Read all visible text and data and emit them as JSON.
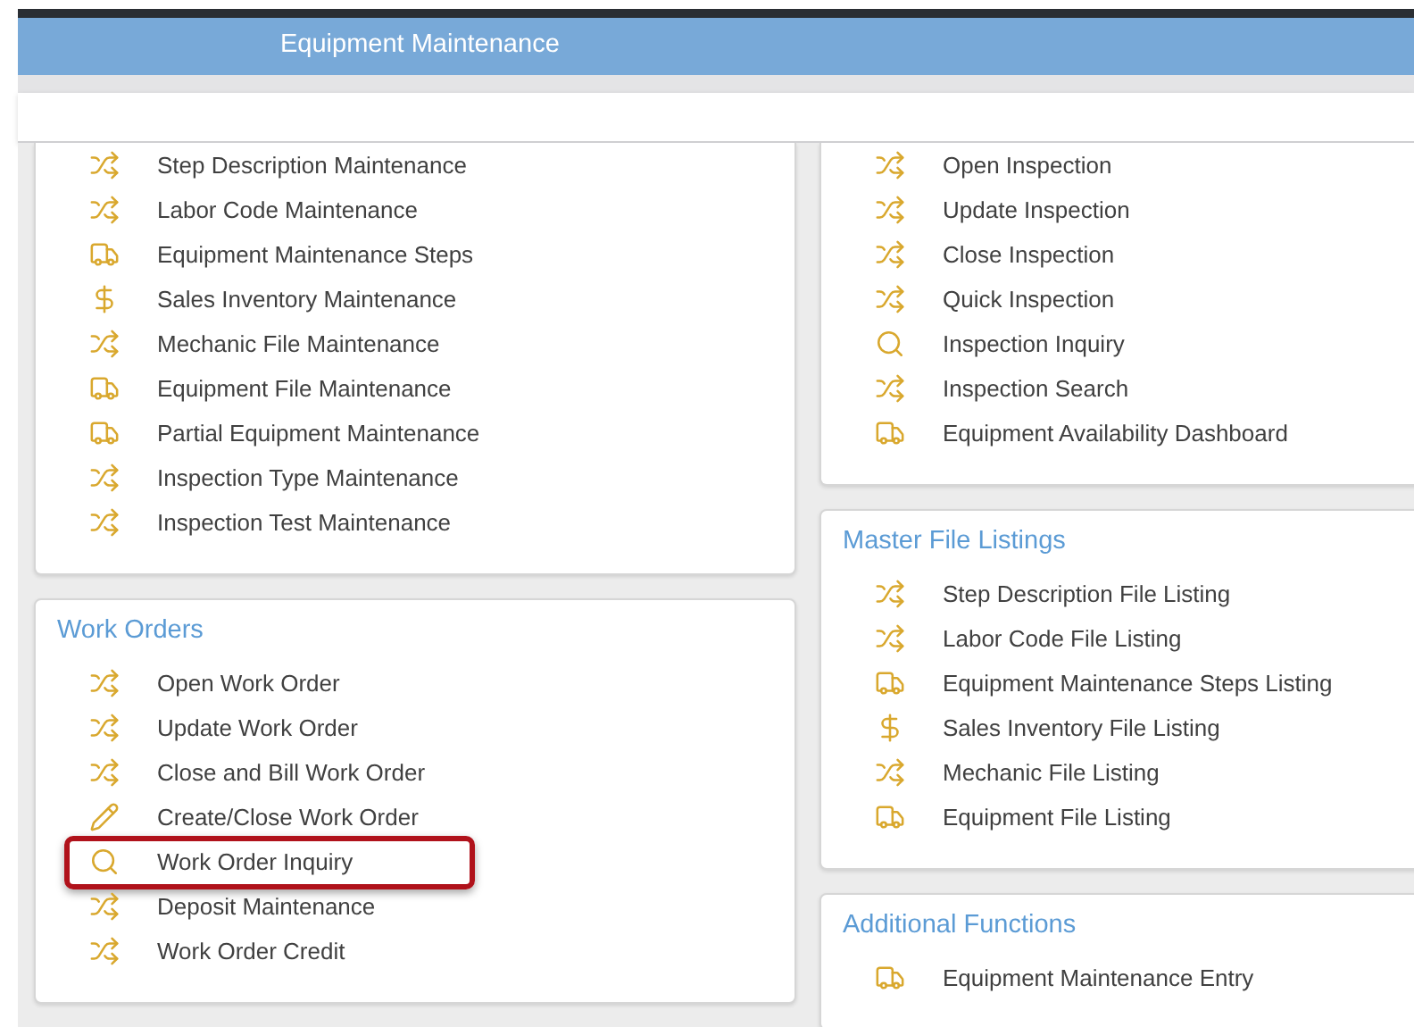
{
  "header": {
    "title": "Equipment Maintenance"
  },
  "columns": [
    [
      {
        "items": [
          {
            "label": "Step Description Maintenance",
            "kind": "shuffle",
            "highlighted": false
          },
          {
            "label": "Labor Code Maintenance",
            "kind": "shuffle",
            "highlighted": false
          },
          {
            "label": "Equipment Maintenance Steps",
            "kind": "truck",
            "highlighted": false
          },
          {
            "label": "Sales Inventory Maintenance",
            "kind": "dollar",
            "highlighted": false
          },
          {
            "label": "Mechanic File Maintenance",
            "kind": "shuffle",
            "highlighted": false
          },
          {
            "label": "Equipment File Maintenance",
            "kind": "truck",
            "highlighted": false
          },
          {
            "label": "Partial Equipment Maintenance",
            "kind": "truck",
            "highlighted": false
          },
          {
            "label": "Inspection Type Maintenance",
            "kind": "shuffle",
            "highlighted": false
          },
          {
            "label": "Inspection Test Maintenance",
            "kind": "shuffle",
            "highlighted": false
          }
        ]
      },
      {
        "heading": "Work Orders",
        "items": [
          {
            "label": "Open Work Order",
            "kind": "shuffle",
            "highlighted": false
          },
          {
            "label": "Update Work Order",
            "kind": "shuffle",
            "highlighted": false
          },
          {
            "label": "Close and Bill Work Order",
            "kind": "shuffle",
            "highlighted": false
          },
          {
            "label": "Create/Close Work Order",
            "kind": "pencil",
            "highlighted": false
          },
          {
            "label": "Work Order Inquiry",
            "kind": "search",
            "highlighted": true
          },
          {
            "label": "Deposit Maintenance",
            "kind": "shuffle",
            "highlighted": false
          },
          {
            "label": "Work Order Credit",
            "kind": "shuffle",
            "highlighted": false
          }
        ]
      }
    ],
    [
      {
        "items": [
          {
            "label": "Open Inspection",
            "kind": "shuffle",
            "highlighted": false
          },
          {
            "label": "Update Inspection",
            "kind": "shuffle",
            "highlighted": false
          },
          {
            "label": "Close Inspection",
            "kind": "shuffle",
            "highlighted": false
          },
          {
            "label": "Quick Inspection",
            "kind": "shuffle",
            "highlighted": false
          },
          {
            "label": "Inspection Inquiry",
            "kind": "search",
            "highlighted": false
          },
          {
            "label": "Inspection Search",
            "kind": "shuffle",
            "highlighted": false
          },
          {
            "label": "Equipment Availability Dashboard",
            "kind": "truck",
            "highlighted": false
          }
        ]
      },
      {
        "heading": "Master File Listings",
        "items": [
          {
            "label": "Step Description File Listing",
            "kind": "shuffle",
            "highlighted": false
          },
          {
            "label": "Labor Code File Listing",
            "kind": "shuffle",
            "highlighted": false
          },
          {
            "label": "Equipment Maintenance Steps Listing",
            "kind": "truck",
            "highlighted": false
          },
          {
            "label": "Sales Inventory File Listing",
            "kind": "dollar",
            "highlighted": false
          },
          {
            "label": "Mechanic File Listing",
            "kind": "shuffle",
            "highlighted": false
          },
          {
            "label": "Equipment File Listing",
            "kind": "truck",
            "highlighted": false
          }
        ]
      },
      {
        "heading": "Additional Functions",
        "items": [
          {
            "label": "Equipment Maintenance Entry",
            "kind": "truck",
            "highlighted": false
          }
        ]
      }
    ]
  ]
}
